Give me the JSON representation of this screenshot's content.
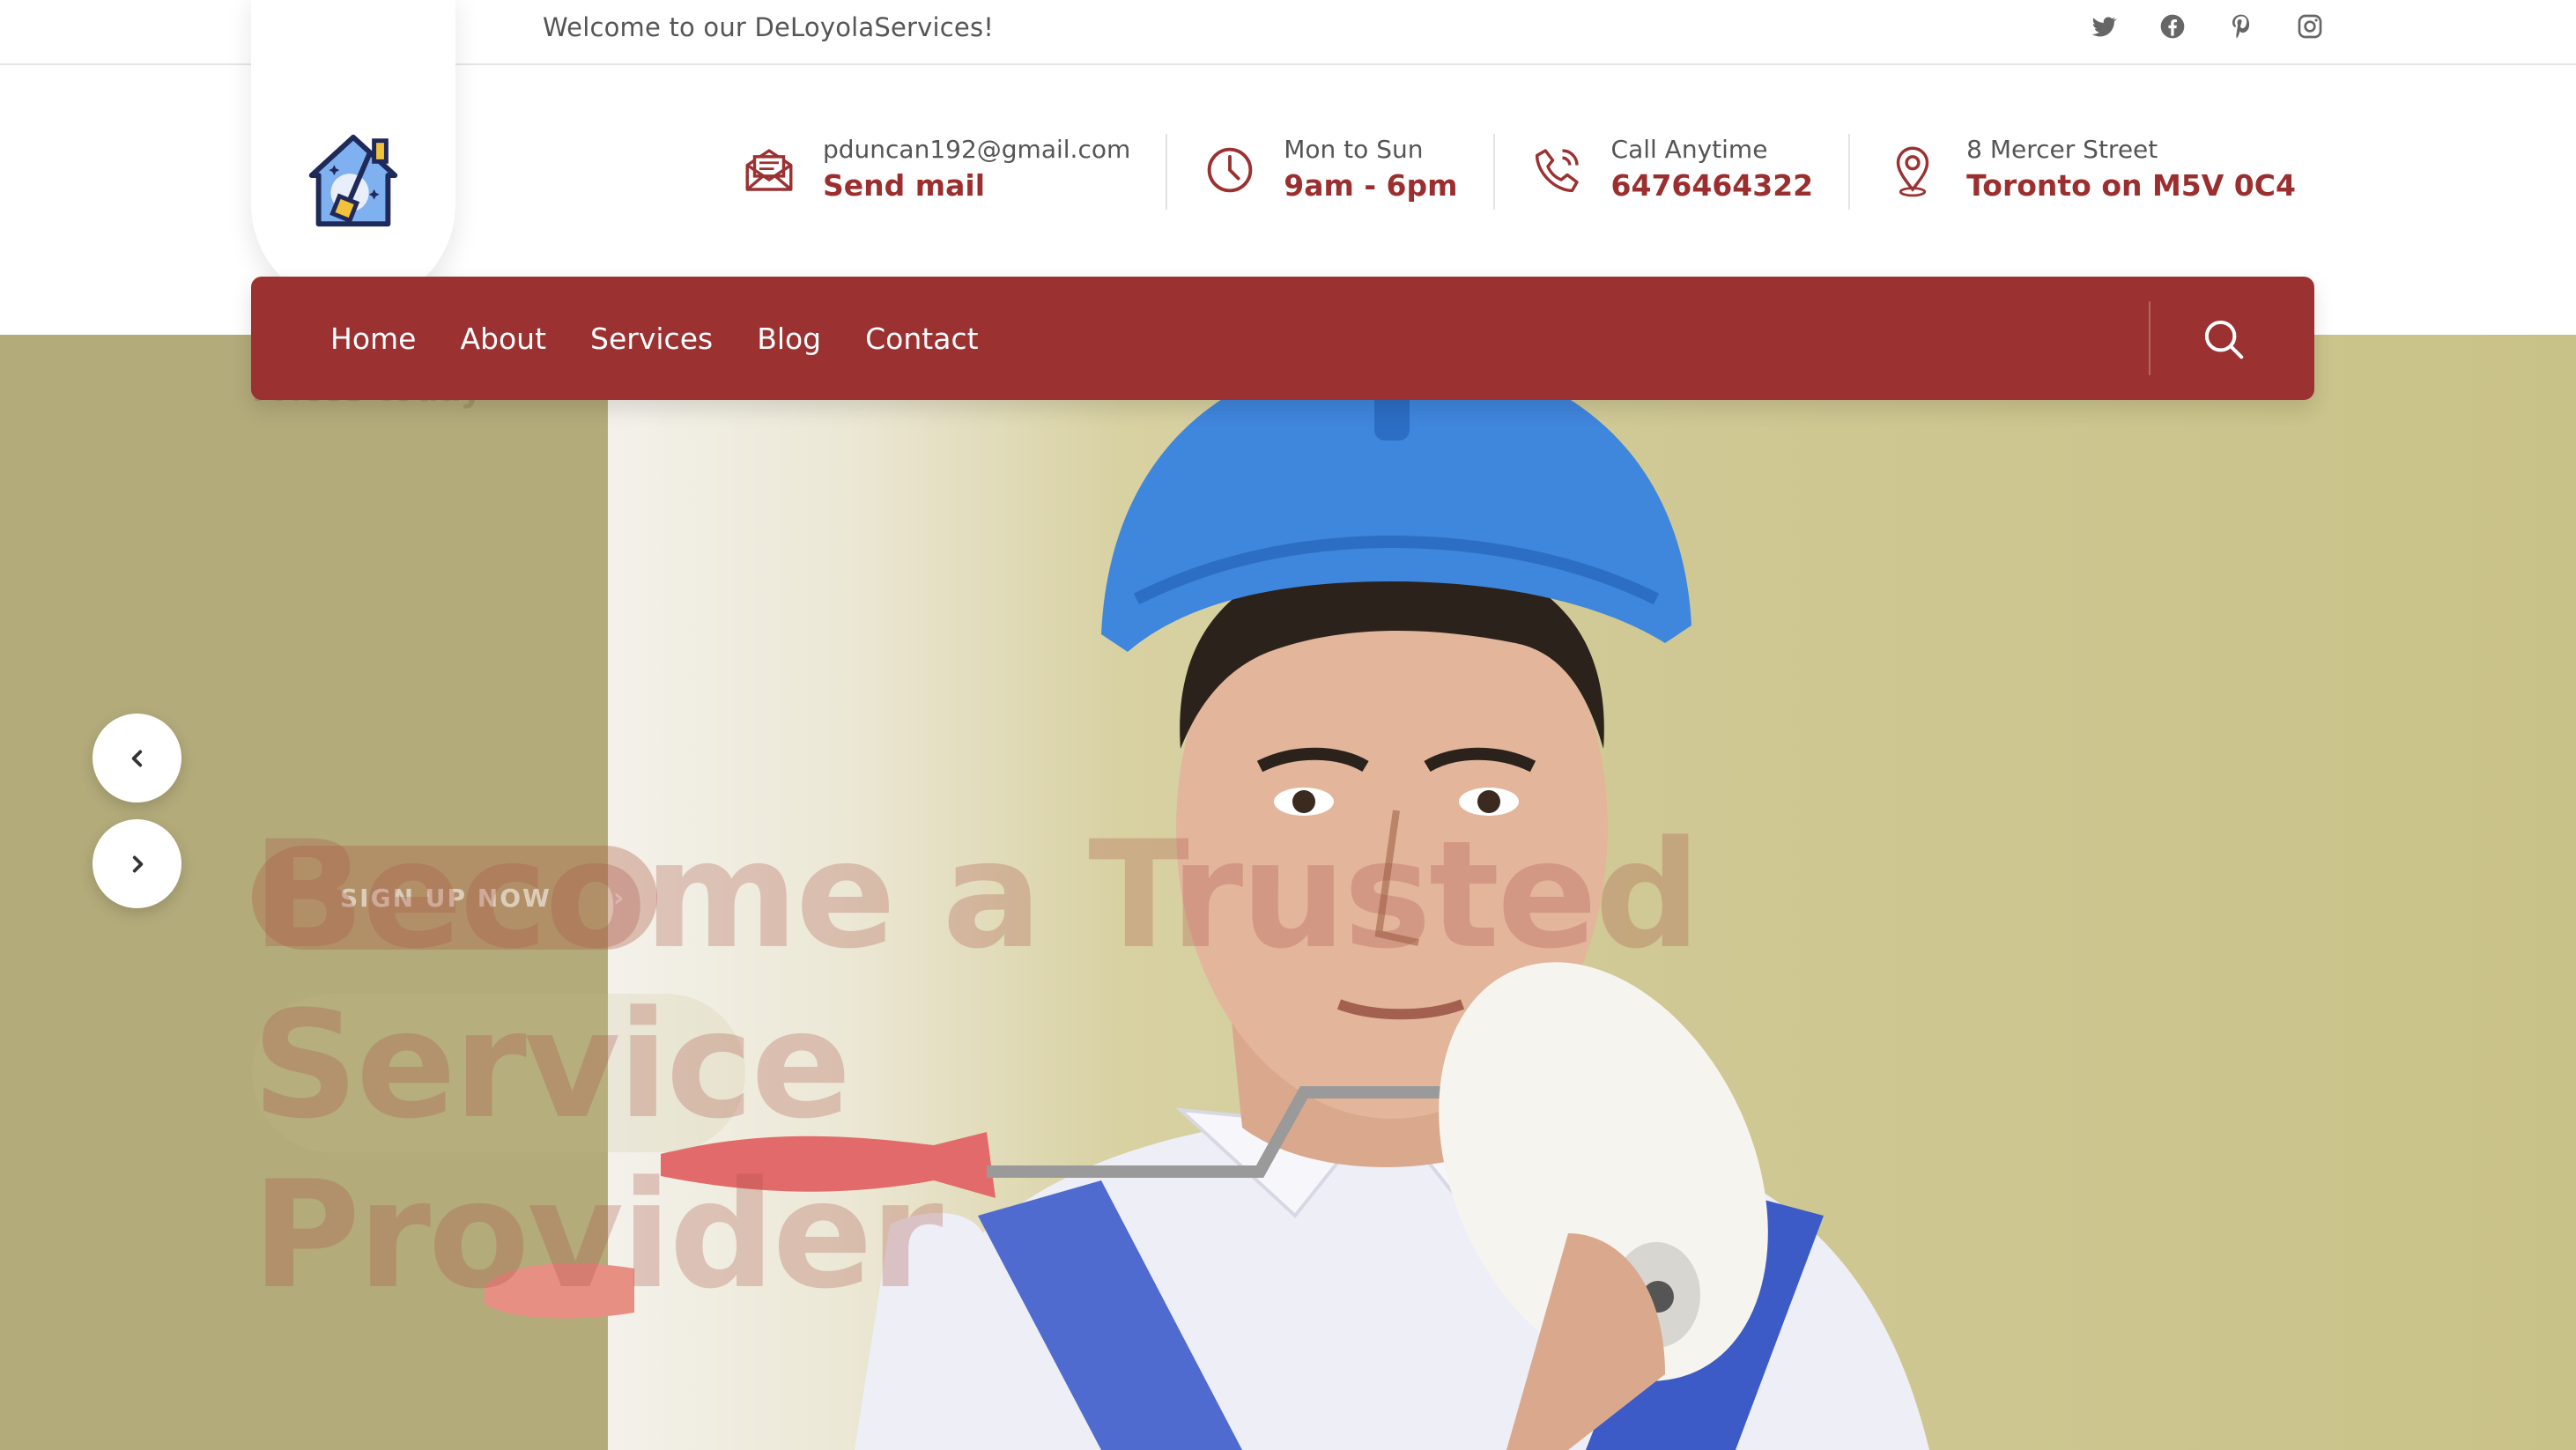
{
  "topbar": {
    "welcome": "Welcome to our DeLoyolaServices!",
    "socials": [
      "twitter-icon",
      "facebook-icon",
      "pinterest-icon",
      "instagram-icon"
    ]
  },
  "header": {
    "logo": "house-broom-logo",
    "contacts": [
      {
        "icon": "mail-icon",
        "line1": "pduncan192@gmail.com",
        "line2": "Send mail"
      },
      {
        "icon": "clock-icon",
        "line1": "Mon to Sun",
        "line2": "9am - 6pm"
      },
      {
        "icon": "phone-icon",
        "line1": "Call Anytime",
        "line2": "6476464322"
      },
      {
        "icon": "location-pin-icon",
        "line1": "8 Mercer Street",
        "line2": "Toronto on M5V 0C4"
      }
    ]
  },
  "nav": {
    "items": [
      "Home",
      "About",
      "Services",
      "Blog",
      "Contact"
    ],
    "search_icon": "search-icon"
  },
  "hero": {
    "faded_line": "rvices today",
    "title_line1": "Become a Trusted Service",
    "title_line2": "Provider",
    "cta_label": "SIGN UP NOW",
    "cta_arrow": "›"
  },
  "colors": {
    "accent": "#9b3131",
    "hero_bg": "#bfb783"
  }
}
